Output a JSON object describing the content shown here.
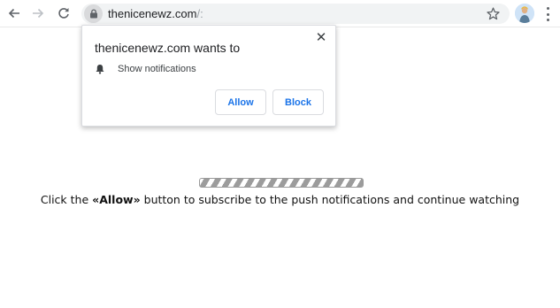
{
  "browser": {
    "url_domain": "thenicenewz.com",
    "url_rest": "/:"
  },
  "popup": {
    "title": "thenicenewz.com wants to",
    "permission_label": "Show notifications",
    "close_glyph": "✕",
    "allow_label": "Allow",
    "block_label": "Block",
    "button_color": "#1a73e8"
  },
  "page": {
    "progress_fraction": 1.0,
    "message_before": "Click the ",
    "message_highlight": "«Allow»",
    "message_after": " button to subscribe to the push notifications and continue watching"
  },
  "icons": {
    "back": "arrow-left-icon",
    "forward": "arrow-right-icon",
    "reload": "reload-icon",
    "lock": "lock-icon",
    "star": "star-icon",
    "avatar": "profile-avatar",
    "menu": "kebab-menu-icon",
    "bell": "bell-icon"
  }
}
